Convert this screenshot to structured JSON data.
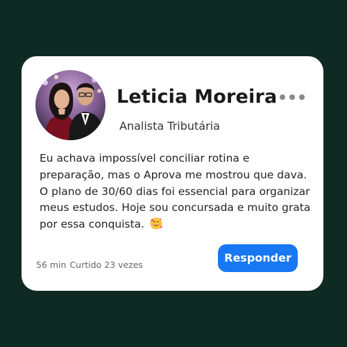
{
  "profile": {
    "name": "Leticia Moreira",
    "role": "Analista Tributária"
  },
  "post": {
    "text": "Eu achava impossível conciliar rotina e preparação, mas o Aprova me mostrou que dava. O plano de 30/60 dias foi essencial para organizar meus estudos. Hoje sou concursada e muito grata por essa conquista.",
    "emoji": "smiling-face-with-hearts-icon"
  },
  "meta": {
    "time": "56 min",
    "likes_prefix": "Curtido",
    "likes_count": "23",
    "likes_suffix": "vezes"
  },
  "actions": {
    "reply_label": "Responder",
    "more_icon": "more-dots-icon"
  },
  "colors": {
    "page_background": "#0f2a22",
    "card_background": "#ffffff",
    "accent": "#1877f2"
  }
}
